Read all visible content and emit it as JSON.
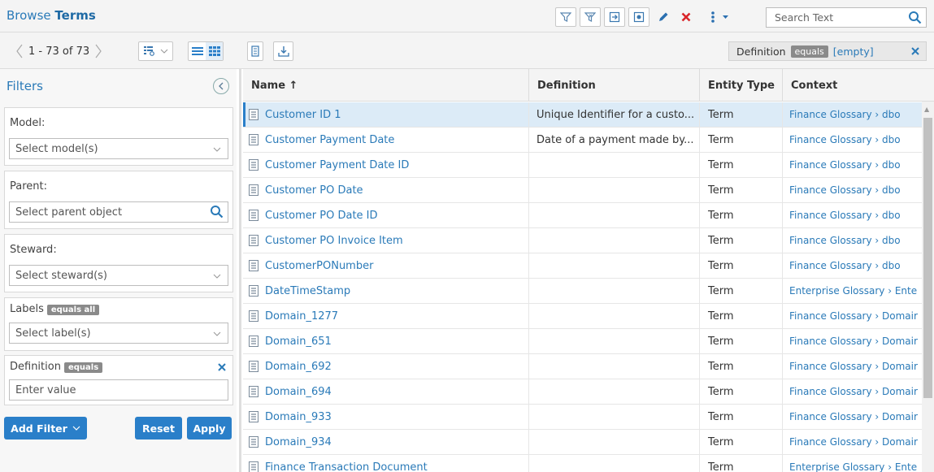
{
  "header": {
    "title_prefix": "Browse",
    "title_bold": "Terms",
    "search_placeholder": "Search Text",
    "toolbar_icons": [
      "filter-funnel-icon",
      "filter-clear-icon",
      "export-icon",
      "import-icon",
      "edit-icon",
      "delete-icon",
      "more-options-icon"
    ]
  },
  "toolbar2": {
    "page_range": "1 - 73 of 73",
    "active_filter": {
      "field": "Definition",
      "operator": "equals",
      "value": "[empty]"
    }
  },
  "sidebar": {
    "title": "Filters",
    "filters": [
      {
        "label": "Model:",
        "placeholder": "Select model(s)",
        "kind": "select"
      },
      {
        "label": "Parent:",
        "placeholder": "Select parent object",
        "kind": "search"
      },
      {
        "label": "Steward:",
        "placeholder": "Select steward(s)",
        "kind": "select"
      },
      {
        "label": "Labels",
        "tag": "equals all",
        "placeholder": "Select label(s)",
        "kind": "select"
      },
      {
        "label": "Definition",
        "tag": "equals",
        "placeholder": "Enter value",
        "kind": "text"
      }
    ],
    "add_filter_label": "Add Filter",
    "reset_label": "Reset",
    "apply_label": "Apply"
  },
  "grid": {
    "columns": [
      "Name ↑",
      "Definition",
      "Entity Type",
      "Context"
    ],
    "rows": [
      {
        "name": "Customer ID 1",
        "definition": "Unique Identifier for a custo...",
        "type": "Term",
        "context": "Finance Glossary › dbo"
      },
      {
        "name": "Customer Payment Date",
        "definition": "Date of a payment made by...",
        "type": "Term",
        "context": "Finance Glossary › dbo"
      },
      {
        "name": "Customer Payment Date ID",
        "definition": "",
        "type": "Term",
        "context": "Finance Glossary › dbo"
      },
      {
        "name": "Customer PO Date",
        "definition": "",
        "type": "Term",
        "context": "Finance Glossary › dbo"
      },
      {
        "name": "Customer PO Date ID",
        "definition": "",
        "type": "Term",
        "context": "Finance Glossary › dbo"
      },
      {
        "name": "Customer PO Invoice Item",
        "definition": "",
        "type": "Term",
        "context": "Finance Glossary › dbo"
      },
      {
        "name": "CustomerPONumber",
        "definition": "",
        "type": "Term",
        "context": "Finance Glossary › dbo"
      },
      {
        "name": "DateTimeStamp",
        "definition": "",
        "type": "Term",
        "context": "Enterprise Glossary › Ente"
      },
      {
        "name": "Domain_1277",
        "definition": "",
        "type": "Term",
        "context": "Finance Glossary › Domair"
      },
      {
        "name": "Domain_651",
        "definition": "",
        "type": "Term",
        "context": "Finance Glossary › Domair"
      },
      {
        "name": "Domain_692",
        "definition": "",
        "type": "Term",
        "context": "Finance Glossary › Domair"
      },
      {
        "name": "Domain_694",
        "definition": "",
        "type": "Term",
        "context": "Finance Glossary › Domair"
      },
      {
        "name": "Domain_933",
        "definition": "",
        "type": "Term",
        "context": "Finance Glossary › Domair"
      },
      {
        "name": "Domain_934",
        "definition": "",
        "type": "Term",
        "context": "Finance Glossary › Domair"
      },
      {
        "name": "Finance Transaction Document",
        "definition": "",
        "type": "Term",
        "context": "Enterprise Glossary › Ente"
      }
    ],
    "selected_row": 0
  },
  "colors": {
    "accent": "#2a7fc9",
    "link": "#2a7ab8",
    "selected_row": "#dcebf7",
    "delete": "#d9262a"
  }
}
